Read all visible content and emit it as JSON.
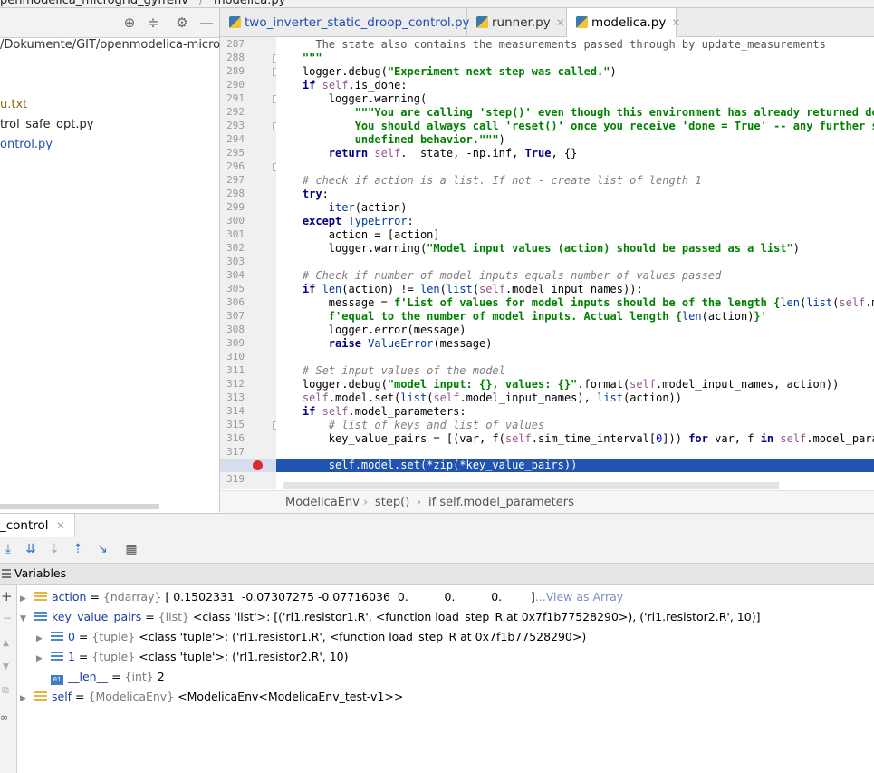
{
  "top_breadcrumb": {
    "project": "penmodelica_microgrid_gym",
    "sep": "/",
    "folder": "env",
    "file": "modelica.py"
  },
  "project_panel": {
    "path": "/Dokumente/GIT/openmodelica-microgr",
    "files": [
      "u.txt",
      "trol_safe_opt.py",
      "ontrol.py"
    ]
  },
  "tabs": [
    {
      "label": "two_inverter_static_droop_control.py",
      "active": false
    },
    {
      "label": "runner.py",
      "active": false
    },
    {
      "label": "modelica.py",
      "active": true
    }
  ],
  "code": {
    "line_numbers": [
      "287",
      "288",
      "289",
      "290",
      "291",
      "292",
      "293",
      "294",
      "295",
      "296",
      "297",
      "298",
      "299",
      "300",
      "301",
      "302",
      "303",
      "304",
      "305",
      "306",
      "307",
      "308",
      "309",
      "310",
      "311",
      "312",
      "313",
      "314",
      "315",
      "316",
      "317",
      "318",
      "319"
    ],
    "current_line": "318"
  },
  "breadcrumb": {
    "class_name": "ModelicaEnv",
    "method": "step()",
    "block": "if self.model_parameters",
    "sep": "›"
  },
  "debug": {
    "tab_label": "_control",
    "panel_title": "Variables",
    "variables": [
      {
        "name": "action",
        "type": "{ndarray}",
        "value": "[ 0.1502331  -0.07307275 -0.07716036  0.          0.          0.        ]",
        "link": "...View as Array"
      },
      {
        "name": "key_value_pairs",
        "type": "{list}",
        "value": "<class 'list'>: [('rl1.resistor1.R', <function load_step_R at 0x7f1b77528290>), ('rl1.resistor2.R', 10)]"
      },
      {
        "name": "0",
        "type": "{tuple}",
        "value": "<class 'tuple'>: ('rl1.resistor1.R', <function load_step_R at 0x7f1b77528290>)"
      },
      {
        "name": "1",
        "type": "{tuple}",
        "value": "<class 'tuple'>: ('rl1.resistor2.R', 10)"
      },
      {
        "name": "__len__",
        "type": "{int}",
        "value": "2",
        "icon_text": "01"
      },
      {
        "name": "self",
        "type": "{ModelicaEnv}",
        "value": "<ModelicaEnv<ModelicaEnv_test-v1>>"
      }
    ]
  },
  "colors": {
    "highlight": "#2154b0",
    "breakpoint": "#d92b2b",
    "keyword": "#000080",
    "string": "#008000"
  }
}
